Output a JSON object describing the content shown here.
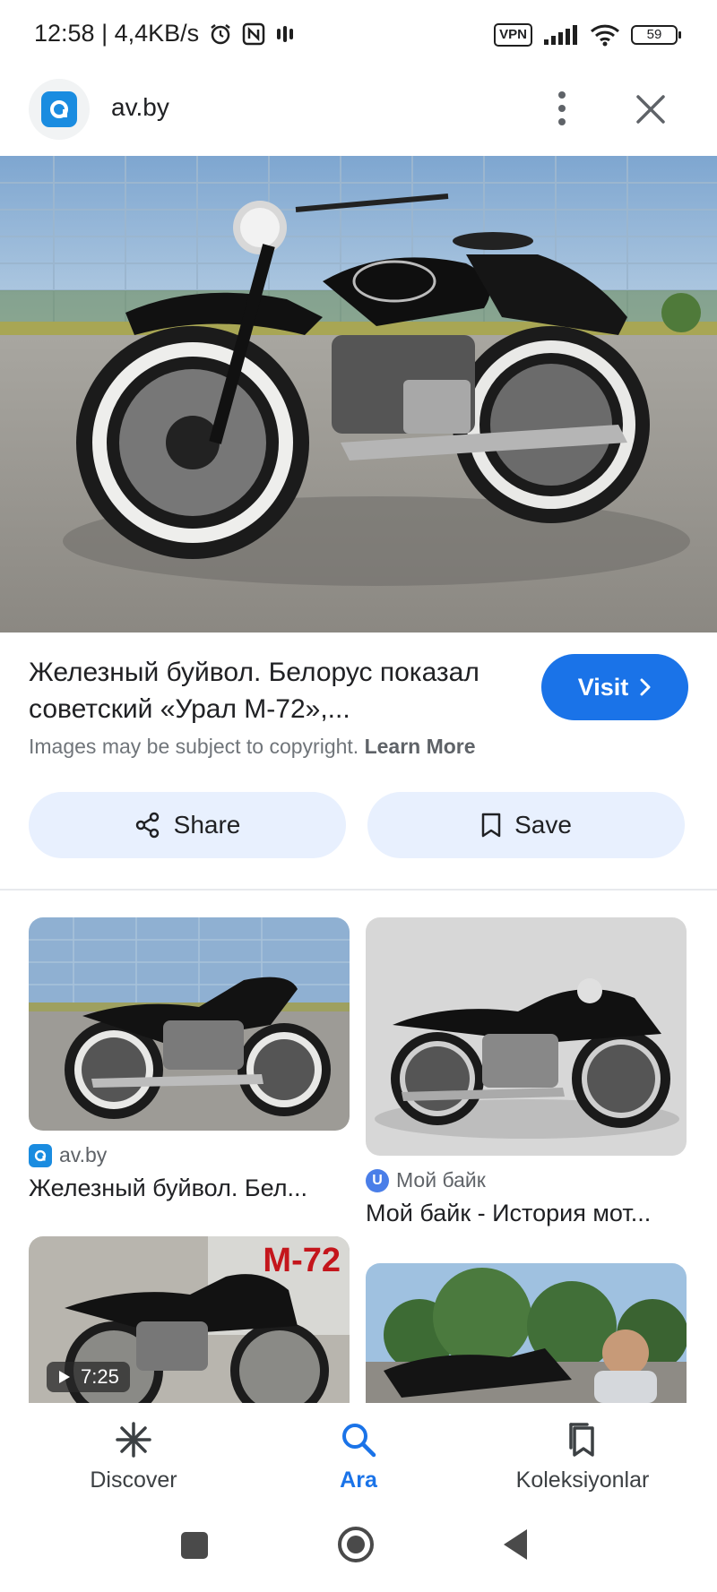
{
  "status_bar": {
    "time_speed": "12:58 | 4,4KB/s",
    "vpn": "VPN",
    "battery": "59"
  },
  "header": {
    "site_name": "av.by"
  },
  "result": {
    "title": "Железный буйвол. Белорус показал советский «Урал М-72»,...",
    "copyright_text": "Images may be subject to copyright.",
    "learn_more": "Learn More",
    "visit_label": "Visit"
  },
  "actions": {
    "share_label": "Share",
    "save_label": "Save"
  },
  "related": [
    {
      "source": "av.by",
      "title": "Железный буйвол. Бел..."
    },
    {
      "source": "Мой байк",
      "title": "Мой байк - История мот..."
    },
    {
      "duration": "7:25",
      "overlay_text": "M-72"
    }
  ],
  "bottom_nav": {
    "discover": "Discover",
    "ara": "Ara",
    "koleksiyonlar": "Koleksiyonlar"
  },
  "colors": {
    "accent": "#1a73e8",
    "pill_bg": "#e8f0fe"
  }
}
